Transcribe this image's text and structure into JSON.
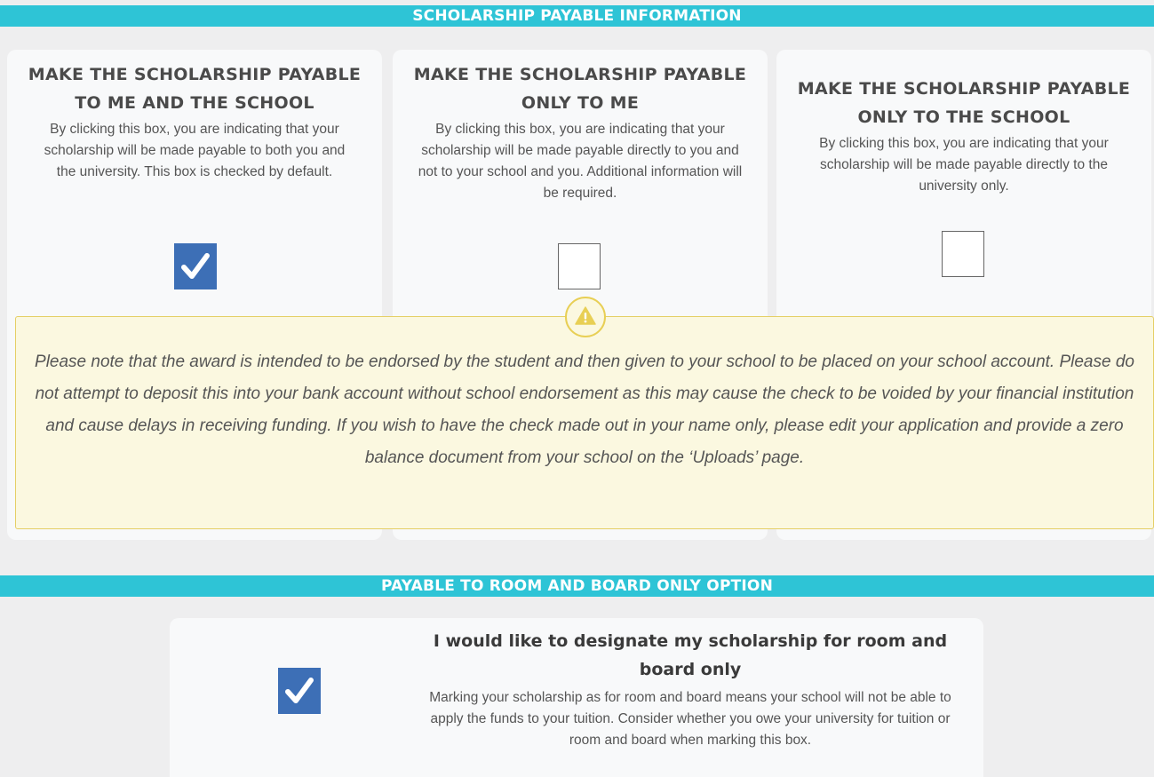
{
  "section1": {
    "title": "SCHOLARSHIP PAYABLE INFORMATION",
    "options": [
      {
        "heading_line1": "MAKE THE SCHOLARSHIP PAYABLE",
        "heading_line2": "TO ME AND THE SCHOOL",
        "description": "By clicking this box, you are indicating that your scholarship will be made payable to both you and the university. This box is checked by default.",
        "checked": true
      },
      {
        "heading_line1": "MAKE THE SCHOLARSHIP PAYABLE",
        "heading_line2": "ONLY TO ME",
        "description": "By clicking this box, you are indicating that your scholarship will be made payable directly to you and not to your school and you. Additional information will be required.",
        "checked": false
      },
      {
        "heading_line1": "MAKE THE SCHOLARSHIP PAYABLE",
        "heading_line2": "ONLY TO THE SCHOOL",
        "description": "By clicking this box, you are indicating that your scholarship will be made payable directly to the university only.",
        "checked": false
      }
    ],
    "notice": {
      "icon": "warning-icon",
      "text": "Please note that the award is intended to be endorsed by the student and then given to your school to be placed on your school account. Please do not attempt to deposit this into your bank account without school endorsement as this may cause the check to be voided by your financial institution and cause delays in receiving funding. If you wish to have the check made out in your name only, please edit your application and provide a zero balance document from your school on the ‘Uploads’ page."
    }
  },
  "section2": {
    "title": "PAYABLE TO ROOM AND BOARD ONLY OPTION",
    "option": {
      "heading_line1": "I would like to designate my scholarship for room and",
      "heading_line2": "board only",
      "description": "Marking your scholarship as for room and board means your school will not be able to apply the funds to your tuition. Consider whether you owe your university for tuition or room and board when marking this box.",
      "checked": true
    }
  },
  "colors": {
    "banner": "#2ec4d6",
    "checkbox_checked": "#3d6fb6",
    "notice_bg": "#fbf8e0",
    "notice_border": "#e5cf65",
    "warning_icon": "#e8cf55"
  }
}
